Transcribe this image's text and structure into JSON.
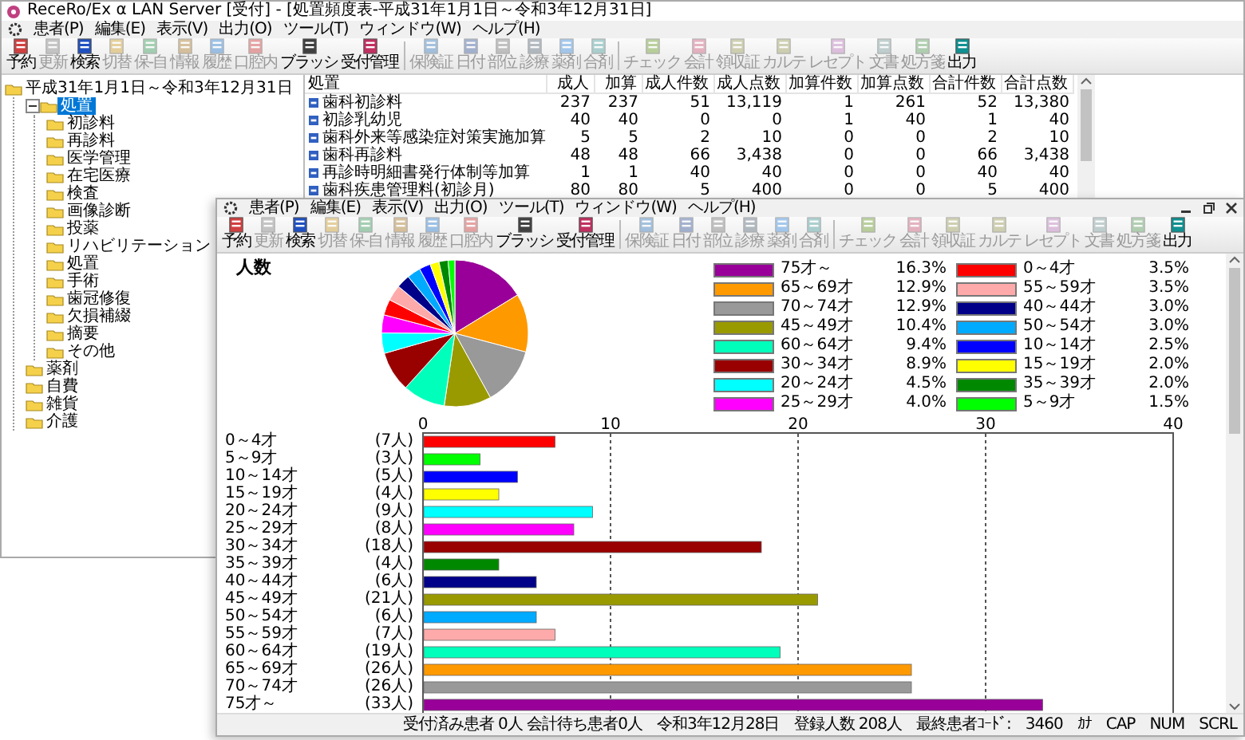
{
  "window": {
    "title": "ReceRo/Ex α LAN Server [受付] - [処置頻度表-平成31年1月1日～令和3年12月31日]"
  },
  "menu": [
    "患者(P)",
    "編集(E)",
    "表示(V)",
    "出力(O)",
    "ツール(T)",
    "ウィンドウ(W)",
    "ヘルプ(H)"
  ],
  "toolbar": [
    [
      {
        "label": "予約",
        "disabled": false
      },
      {
        "label": "更新",
        "disabled": true
      },
      {
        "label": "検索",
        "disabled": false
      },
      {
        "label": "切替",
        "disabled": true
      },
      {
        "label": "保-自",
        "disabled": true
      },
      {
        "label": "情報",
        "disabled": true
      },
      {
        "label": "履歴",
        "disabled": true
      },
      {
        "label": "口腔内",
        "disabled": true
      },
      {
        "label": "ブラッシ",
        "disabled": false
      },
      {
        "label": "受付管理",
        "disabled": false
      }
    ],
    [
      {
        "label": "保険証",
        "disabled": true
      },
      {
        "label": "日付",
        "disabled": true
      },
      {
        "label": "部位",
        "disabled": true
      },
      {
        "label": "診療",
        "disabled": true
      },
      {
        "label": "薬剤",
        "disabled": true
      },
      {
        "label": "合剤",
        "disabled": true
      }
    ],
    [
      {
        "label": "チェック",
        "disabled": true
      },
      {
        "label": "会計",
        "disabled": true
      },
      {
        "label": "領収証",
        "disabled": true
      },
      {
        "label": "カルテ",
        "disabled": true
      },
      {
        "label": "レセプト",
        "disabled": true
      },
      {
        "label": "文書",
        "disabled": true
      },
      {
        "label": "処方箋",
        "disabled": true
      },
      {
        "label": "出力",
        "disabled": false
      }
    ]
  ],
  "tree": {
    "label": "平成31年1月1日～令和3年12月31日",
    "children": [
      {
        "label": "処置",
        "selected": true,
        "expanded": true,
        "children": [
          {
            "label": "初診料",
            "selected": false
          },
          {
            "label": "再診料",
            "selected": false
          },
          {
            "label": "医学管理",
            "selected": false
          },
          {
            "label": "在宅医療",
            "selected": false
          },
          {
            "label": "検査",
            "selected": false
          },
          {
            "label": "画像診断",
            "selected": false
          },
          {
            "label": "投薬",
            "selected": false
          },
          {
            "label": "リハビリテーション",
            "selected": false
          },
          {
            "label": "処置",
            "selected": false
          },
          {
            "label": "手術",
            "selected": false
          },
          {
            "label": "歯冠修復",
            "selected": false
          },
          {
            "label": "欠損補綴",
            "selected": false
          },
          {
            "label": "摘要",
            "selected": false
          },
          {
            "label": "その他",
            "selected": false
          }
        ]
      },
      {
        "label": "薬剤",
        "selected": false
      },
      {
        "label": "自費",
        "selected": false
      },
      {
        "label": "雑貨",
        "selected": false
      },
      {
        "label": "介護",
        "selected": false
      }
    ]
  },
  "table": {
    "columns": [
      "処置",
      "成人",
      "加算",
      "成人件数",
      "成人点数",
      "加算件数",
      "加算点数",
      "合計件数",
      "合計点数"
    ],
    "rows": [
      [
        "歯科初診料",
        "237",
        "237",
        "51",
        "13,119",
        "1",
        "261",
        "52",
        "13,380"
      ],
      [
        "初診乳幼児",
        "40",
        "40",
        "0",
        "0",
        "1",
        "40",
        "1",
        "40"
      ],
      [
        "歯科外来等感染症対策実施加算",
        "5",
        "5",
        "2",
        "10",
        "0",
        "0",
        "2",
        "10"
      ],
      [
        "歯科再診料",
        "48",
        "48",
        "66",
        "3,438",
        "0",
        "0",
        "66",
        "3,438"
      ],
      [
        "再診時明細書発行体制等加算",
        "1",
        "1",
        "40",
        "40",
        "0",
        "0",
        "40",
        "40"
      ],
      [
        "歯科疾患管理料(初診月)",
        "80",
        "80",
        "5",
        "400",
        "0",
        "0",
        "5",
        "400"
      ]
    ]
  },
  "report_window": {
    "menu": [
      "患者(P)",
      "編集(E)",
      "表示(V)",
      "出力(O)",
      "ツール(T)",
      "ウィンドウ(W)",
      "ヘルプ(H)"
    ],
    "toolbar": [
      [
        {
          "label": "予約",
          "disabled": false
        },
        {
          "label": "更新",
          "disabled": true
        },
        {
          "label": "検索",
          "disabled": false
        },
        {
          "label": "切替",
          "disabled": true
        },
        {
          "label": "保-自",
          "disabled": true
        },
        {
          "label": "情報",
          "disabled": true
        },
        {
          "label": "履歴",
          "disabled": true
        },
        {
          "label": "口腔内",
          "disabled": true
        },
        {
          "label": "ブラッシ",
          "disabled": false
        },
        {
          "label": "受付管理",
          "disabled": false
        }
      ],
      [
        {
          "label": "保険証",
          "disabled": true
        },
        {
          "label": "日付",
          "disabled": true
        },
        {
          "label": "部位",
          "disabled": true
        },
        {
          "label": "診療",
          "disabled": true
        },
        {
          "label": "薬剤",
          "disabled": true
        },
        {
          "label": "合剤",
          "disabled": true
        }
      ],
      [
        {
          "label": "チェック",
          "disabled": true
        },
        {
          "label": "会計",
          "disabled": true
        },
        {
          "label": "領収証",
          "disabled": true
        },
        {
          "label": "カルテ",
          "disabled": true
        },
        {
          "label": "レセプト",
          "disabled": true
        },
        {
          "label": "文書",
          "disabled": true
        },
        {
          "label": "処方箋",
          "disabled": true
        },
        {
          "label": "出力",
          "disabled": false
        }
      ]
    ],
    "heading": "人数",
    "pie": {
      "chart_data": {
        "type": "pie",
        "categories": [
          "75才～",
          "65～69才",
          "70～74才",
          "45～49才",
          "60～64才",
          "30～34才",
          "20～24才",
          "25～29才",
          "0～4才",
          "55～59才",
          "40～44才",
          "50～54才",
          "10～14才",
          "15～19才",
          "35～39才",
          "5～9才"
        ],
        "values": [
          16.3,
          12.9,
          12.9,
          10.4,
          9.4,
          8.9,
          4.5,
          4.0,
          3.5,
          3.5,
          3.0,
          3.0,
          2.5,
          2.0,
          2.0,
          1.5
        ],
        "legend": "right",
        "colors": [
          "#990099",
          "#ff9900",
          "#999999",
          "#999900",
          "#00ffbb",
          "#990000",
          "#00ffff",
          "#ff00ff",
          "#ff0000",
          "#ffaaaa",
          "#000088",
          "#00aaff",
          "#0000ff",
          "#ffff00",
          "#008800",
          "#00ff00"
        ],
        "value_labels": [
          "16.3%",
          "12.9%",
          "12.9%",
          "10.4%",
          "9.4%",
          "8.9%",
          "4.5%",
          "4.0%",
          "3.5%",
          "3.5%",
          "3.0%",
          "3.0%",
          "2.5%",
          "2.0%",
          "2.0%",
          "1.5%"
        ]
      }
    },
    "bar": {
      "chart_data": {
        "type": "bar",
        "orientation": "horizontal",
        "categories": [
          "0～4才",
          "5～9才",
          "10～14才",
          "15～19才",
          "20～24才",
          "25～29才",
          "30～34才",
          "35～39才",
          "40～44才",
          "45～49才",
          "50～54才",
          "55～59才",
          "60～64才",
          "65～69才",
          "70～74才",
          "75才～"
        ],
        "values": [
          7,
          3,
          5,
          4,
          9,
          8,
          18,
          4,
          6,
          21,
          6,
          7,
          19,
          26,
          26,
          33
        ],
        "grid": true,
        "colors": [
          "#ff0000",
          "#00ff00",
          "#0000ff",
          "#ffff00",
          "#00ffff",
          "#ff00ff",
          "#990000",
          "#008800",
          "#000088",
          "#999900",
          "#00aaff",
          "#ffaaaa",
          "#00ffbb",
          "#ff9900",
          "#999999",
          "#990099"
        ],
        "value_labels": [
          "(7人)",
          "(3人)",
          "(5人)",
          "(4人)",
          "(9人)",
          "(8人)",
          "(18人)",
          "(4人)",
          "(6人)",
          "(21人)",
          "(6人)",
          "(7人)",
          "(19人)",
          "(26人)",
          "(26人)",
          "(33人)"
        ],
        "xlim": [
          0,
          40
        ],
        "xticks": [
          0,
          10,
          20,
          30,
          40
        ]
      }
    },
    "status_bar": [
      "受付済み患者 0人 会計待ち患者0人",
      "令和3年12月28日",
      "登録人数 208人",
      "最終患者ｺｰﾄﾞ:",
      "3460",
      "ｶﾅ",
      "CAP",
      "NUM",
      "SCRL"
    ]
  }
}
